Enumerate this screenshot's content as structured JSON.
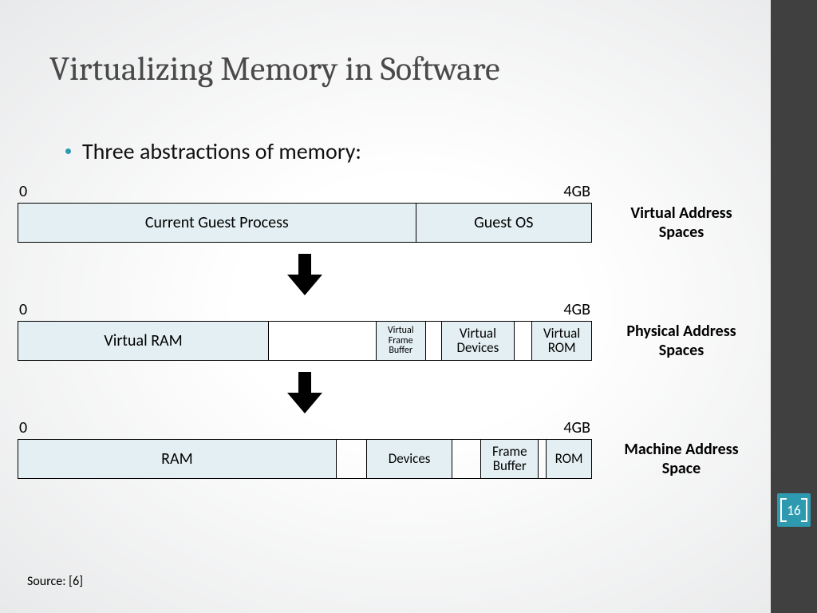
{
  "title": "Virtualizing Memory in Software",
  "bullet": "Three abstractions of memory:",
  "scale": {
    "start": "0",
    "end": "4GB"
  },
  "layers": {
    "virtual": {
      "label": "Virtual Address Spaces",
      "segs": {
        "guest_process": "Current Guest Process",
        "guest_os": "Guest OS"
      }
    },
    "physical": {
      "label": "Physical Address Spaces",
      "segs": {
        "vram": "Virtual RAM",
        "vfb": "Virtual Frame Buffer",
        "vdev": "Virtual Devices",
        "vrom": "Virtual ROM"
      }
    },
    "machine": {
      "label": "Machine Address Space",
      "segs": {
        "ram": "RAM",
        "dev": "Devices",
        "fb": "Frame Buffer",
        "rom": "ROM"
      }
    }
  },
  "source": "Source: [6]",
  "page": "16"
}
